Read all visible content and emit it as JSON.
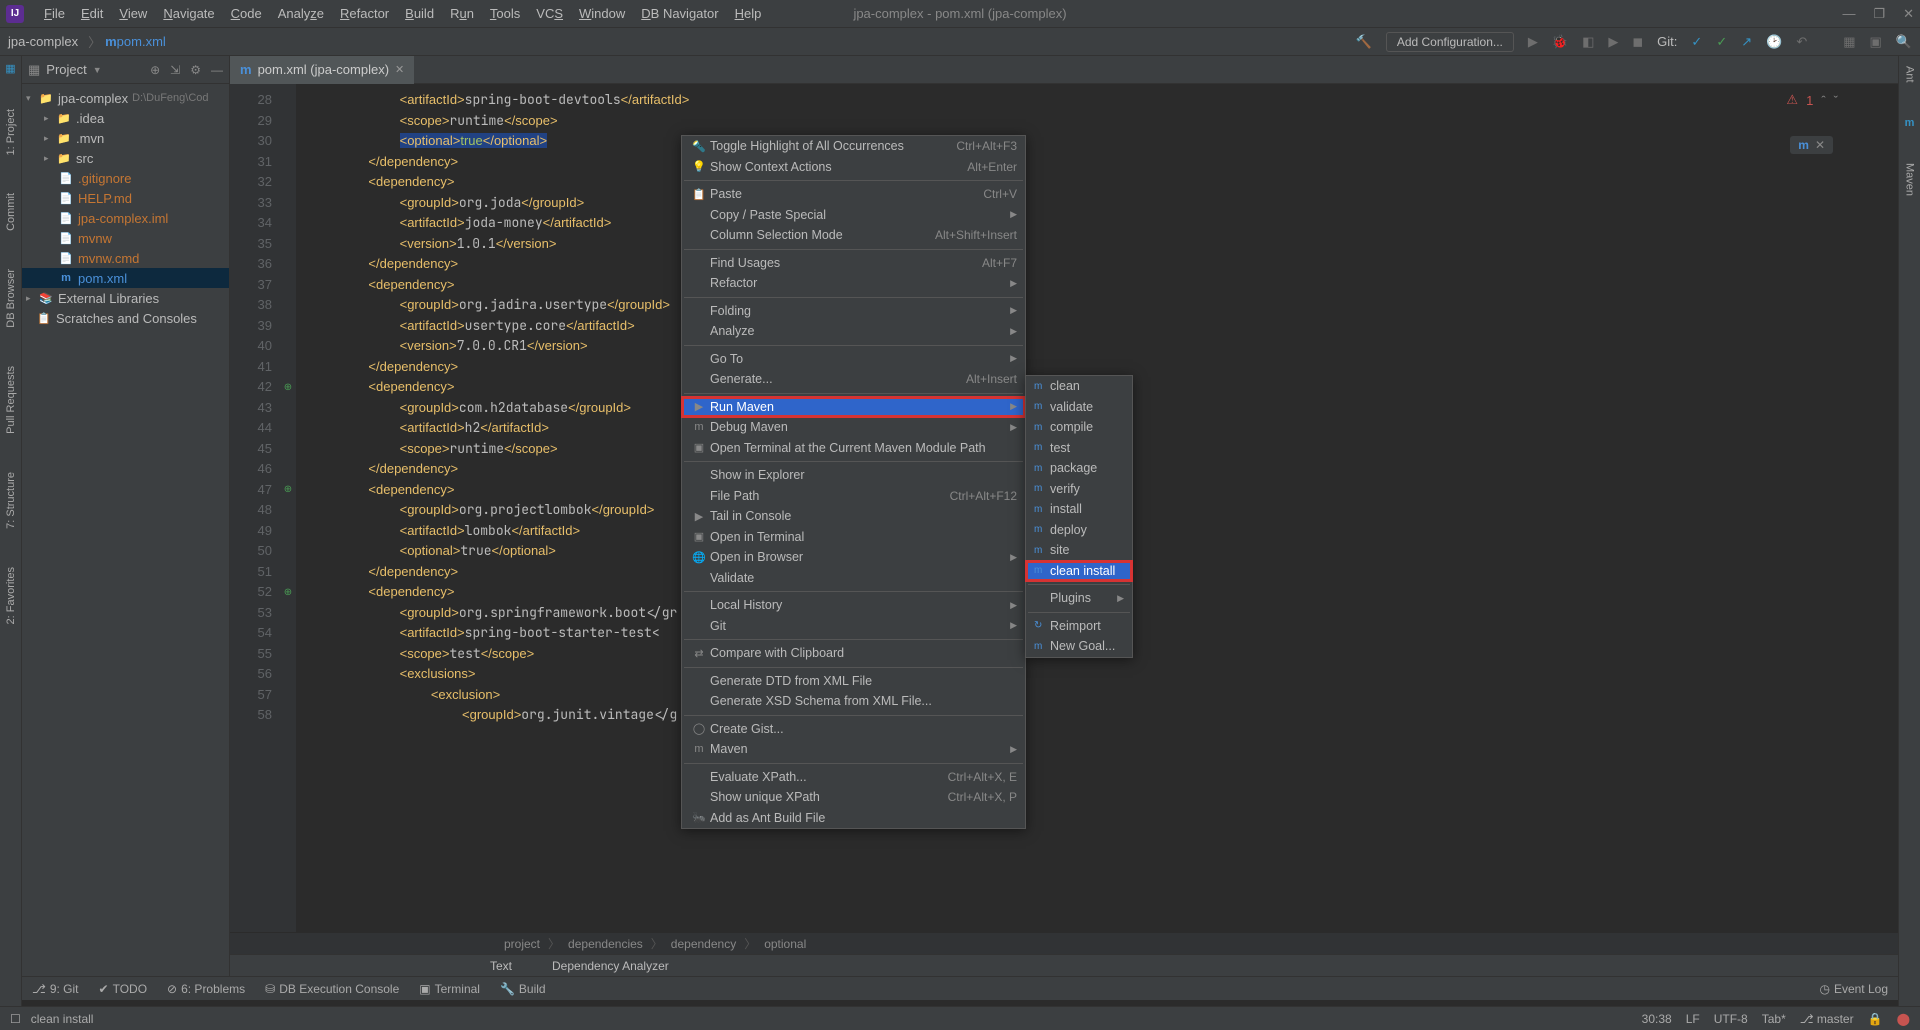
{
  "window": {
    "title": "jpa-complex - pom.xml (jpa-complex)"
  },
  "menubar": [
    "File",
    "Edit",
    "View",
    "Navigate",
    "Code",
    "Analyze",
    "Refactor",
    "Build",
    "Run",
    "Tools",
    "VCS",
    "Window",
    "DB Navigator",
    "Help"
  ],
  "navbar": {
    "proj": "jpa-complex",
    "file": "pom.xml"
  },
  "toolbar": {
    "addConfig": "Add Configuration...",
    "gitLabel": "Git:"
  },
  "leftTabs": [
    "1: Project",
    "Commit",
    "DB Browser",
    "Pull Requests",
    "7: Structure",
    "2: Favorites"
  ],
  "rightTabs": [
    "Ant",
    "Maven"
  ],
  "projectPanel": {
    "title": "Project",
    "root": "jpa-complex",
    "rootPath": "D:\\DuFeng\\Cod",
    "items": [
      ".idea",
      ".mvn",
      "src",
      ".gitignore",
      "HELP.md",
      "jpa-complex.iml",
      "mvnw",
      "mvnw.cmd",
      "pom.xml"
    ],
    "external": "External Libraries",
    "scratches": "Scratches and Consoles"
  },
  "tab": {
    "label": "pom.xml (jpa-complex)"
  },
  "gutterStart": 28,
  "code": [
    "            <artifactId>spring-boot-devtools</artifactId>",
    "            <scope>runtime</scope>",
    "            <optional>true</optional>",
    "        </dependency>",
    "        <dependency>",
    "            <groupId>org.joda</groupId>",
    "            <artifactId>joda-money</artifactId>",
    "            <version>1.0.1</version>",
    "        </dependency>",
    "        <dependency>",
    "            <groupId>org.jadira.usertype</groupId>",
    "            <artifactId>usertype.core</artifactId>",
    "            <version>7.0.0.CR1</version>",
    "        </dependency>",
    "        <dependency>",
    "            <groupId>com.h2database</groupId>",
    "            <artifactId>h2</artifactId>",
    "            <scope>runtime</scope>",
    "        </dependency>",
    "        <dependency>",
    "            <groupId>org.projectlombok</groupId>",
    "            <artifactId>lombok</artifactId>",
    "            <optional>true</optional>",
    "        </dependency>",
    "        <dependency>",
    "            <groupId>org.springframework.boot</gr",
    "            <artifactId>spring-boot-starter-test<",
    "            <scope>test</scope>",
    "            <exclusions>",
    "                <exclusion>",
    "                    <groupId>org.junit.vintage</g"
  ],
  "banner": {
    "err": "1"
  },
  "breadcrumbs": [
    "project",
    "dependencies",
    "dependency",
    "optional"
  ],
  "bottomTabs": [
    "Text",
    "Dependency Analyzer"
  ],
  "toolWindows": [
    "9: Git",
    "TODO",
    "6: Problems",
    "DB Execution Console",
    "Terminal",
    "Build"
  ],
  "toolRight": "Event Log",
  "statusbar": {
    "text": "clean install",
    "pos": "30:38",
    "enc": "LF",
    "cs": "UTF-8",
    "tab": "Tab*",
    "branch": "master"
  },
  "contextMenu": [
    {
      "label": "Toggle Highlight of All Occurrences",
      "shortcut": "Ctrl+Alt+F3",
      "icon": "🔦"
    },
    {
      "label": "Show Context Actions",
      "shortcut": "Alt+Enter",
      "icon": "💡"
    },
    {
      "sep": true
    },
    {
      "label": "Paste",
      "shortcut": "Ctrl+V",
      "icon": "📋"
    },
    {
      "label": "Copy / Paste Special",
      "sub": true
    },
    {
      "label": "Column Selection Mode",
      "shortcut": "Alt+Shift+Insert"
    },
    {
      "sep": true
    },
    {
      "label": "Find Usages",
      "shortcut": "Alt+F7"
    },
    {
      "label": "Refactor",
      "sub": true
    },
    {
      "sep": true
    },
    {
      "label": "Folding",
      "sub": true
    },
    {
      "label": "Analyze",
      "sub": true
    },
    {
      "sep": true
    },
    {
      "label": "Go To",
      "sub": true
    },
    {
      "label": "Generate...",
      "shortcut": "Alt+Insert"
    },
    {
      "sep": true
    },
    {
      "label": "Run Maven",
      "sub": true,
      "hl": true,
      "boxed": true,
      "icon": "▶"
    },
    {
      "label": "Debug Maven",
      "sub": true,
      "icon": "m"
    },
    {
      "label": "Open Terminal at the Current Maven Module Path",
      "icon": "▣"
    },
    {
      "sep": true
    },
    {
      "label": "Show in Explorer"
    },
    {
      "label": "File Path",
      "shortcut": "Ctrl+Alt+F12"
    },
    {
      "label": "Tail in Console",
      "icon": "▶"
    },
    {
      "label": "Open in Terminal",
      "icon": "▣"
    },
    {
      "label": "Open in Browser",
      "sub": true,
      "icon": "🌐"
    },
    {
      "label": "Validate"
    },
    {
      "sep": true
    },
    {
      "label": "Local History",
      "sub": true
    },
    {
      "label": "Git",
      "sub": true
    },
    {
      "sep": true
    },
    {
      "label": "Compare with Clipboard",
      "icon": "⇄"
    },
    {
      "sep": true
    },
    {
      "label": "Generate DTD from XML File"
    },
    {
      "label": "Generate XSD Schema from XML File..."
    },
    {
      "sep": true
    },
    {
      "label": "Create Gist...",
      "icon": "◯"
    },
    {
      "label": "Maven",
      "sub": true,
      "icon": "m"
    },
    {
      "sep": true
    },
    {
      "label": "Evaluate XPath...",
      "shortcut": "Ctrl+Alt+X, E"
    },
    {
      "label": "Show unique XPath",
      "shortcut": "Ctrl+Alt+X, P"
    },
    {
      "label": "Add as Ant Build File",
      "icon": "🐜"
    }
  ],
  "submenu": [
    {
      "label": "clean"
    },
    {
      "label": "validate"
    },
    {
      "label": "compile"
    },
    {
      "label": "test"
    },
    {
      "label": "package"
    },
    {
      "label": "verify"
    },
    {
      "label": "install"
    },
    {
      "label": "deploy"
    },
    {
      "label": "site"
    },
    {
      "label": "clean install",
      "hl": true,
      "boxed": true
    },
    {
      "sep": true
    },
    {
      "label": "Plugins",
      "sub": true
    },
    {
      "sep": true
    },
    {
      "label": "Reimport",
      "icon": "↻"
    },
    {
      "label": "New Goal..."
    }
  ]
}
